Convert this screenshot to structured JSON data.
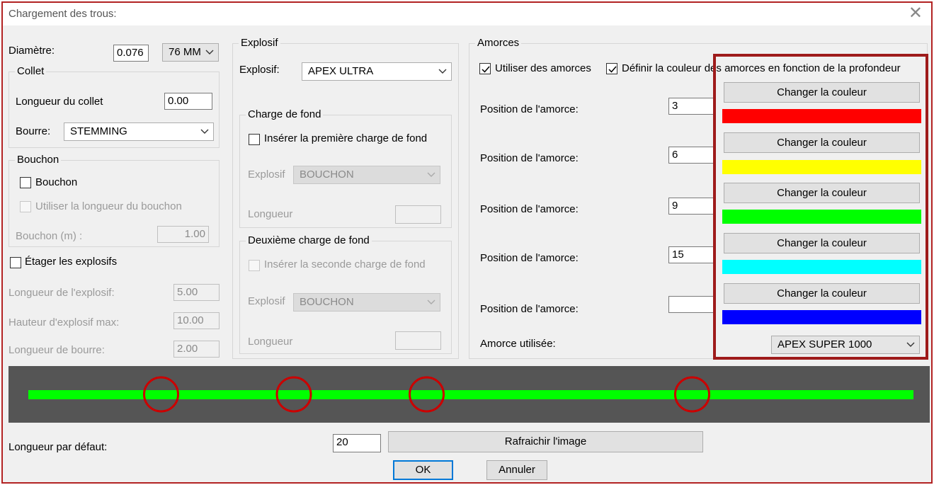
{
  "window": {
    "title": "Chargement des trous:"
  },
  "diametre": {
    "label": "Diamètre:",
    "value": "0.076",
    "unit": "76 MM"
  },
  "collet": {
    "title": "Collet",
    "longueur_label": "Longueur du collet",
    "longueur_value": "0.00",
    "bourre_label": "Bourre:",
    "bourre_value": "STEMMING"
  },
  "bouchon": {
    "title": "Bouchon",
    "check_label": "Bouchon",
    "use_length_label": "Utiliser la longueur du bouchon",
    "length_label": "Bouchon (m) :",
    "length_value": "1.00"
  },
  "etager": {
    "check_label": "Étager les explosifs",
    "longueur_explosif_label": "Longueur de l'explosif:",
    "longueur_explosif_value": "5.00",
    "hauteur_label": "Hauteur d'explosif max:",
    "hauteur_value": "10.00",
    "bourre_label": "Longueur de bourre:",
    "bourre_value": "2.00"
  },
  "explosif": {
    "title": "Explosif",
    "label": "Explosif:",
    "value": "APEX ULTRA",
    "charge1": {
      "title": "Charge de fond",
      "check_label": "Insérer la première charge de fond",
      "explosif_label": "Explosif",
      "explosif_value": "BOUCHON",
      "longueur_label": "Longueur",
      "longueur_value": ""
    },
    "charge2": {
      "title": "Deuxième charge de fond",
      "check_label": "Insérer la seconde charge de fond",
      "explosif_label": "Explosif",
      "explosif_value": "BOUCHON",
      "longueur_label": "Longueur",
      "longueur_value": ""
    }
  },
  "amorces": {
    "title": "Amorces",
    "use_label": "Utiliser des amorces",
    "color_depth_label": "Définir la couleur des amorces en fonction de la profondeur",
    "position_label": "Position de l'amorce:",
    "rows": [
      {
        "value": "3",
        "button": "Changer la couleur",
        "color": "#ff0000"
      },
      {
        "value": "6",
        "button": "Changer la couleur",
        "color": "#ffff00"
      },
      {
        "value": "9",
        "button": "Changer la couleur",
        "color": "#00ff00"
      },
      {
        "value": "15",
        "button": "Changer la couleur",
        "color": "#00ffff"
      },
      {
        "value": "",
        "button": "Changer la couleur",
        "color": "#0000ff"
      }
    ],
    "used_label": "Amorce utilisée:",
    "used_value": "APEX SUPER 1000"
  },
  "preview": {
    "background": "#555555",
    "bar_color": "#00ff00",
    "marker_color": "#cc0000",
    "primer_positions": [
      3,
      6,
      9,
      15
    ]
  },
  "bottom": {
    "default_length_label": "Longueur par défaut:",
    "default_length_value": "20",
    "refresh_label": "Rafraichir l'image",
    "ok_label": "OK",
    "cancel_label": "Annuler"
  }
}
